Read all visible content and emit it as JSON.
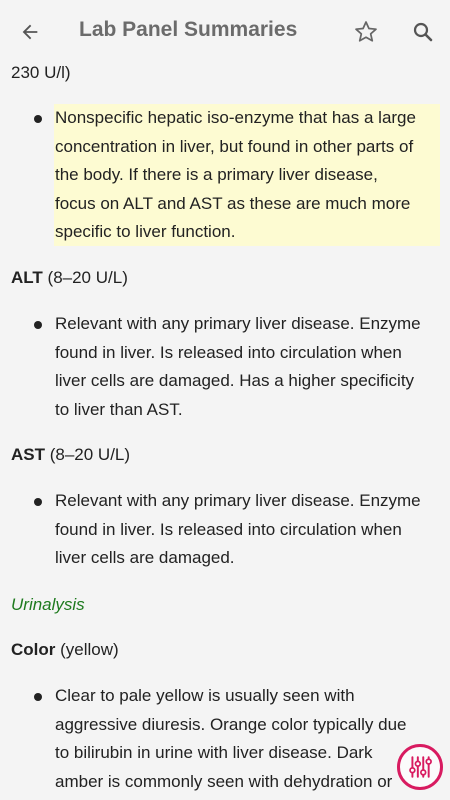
{
  "app_bar": {
    "title": "Lab Panel Summaries",
    "icons": {
      "back": "arrow-back-icon",
      "favorite": "star-outline-icon",
      "search": "search-icon"
    }
  },
  "content": {
    "top_fragment": "230 U/l)",
    "ggt_bullet": {
      "lines": [
        "Nonspecific hepatic iso-enzyme that has a large",
        "concentration in liver, but found in other parts of",
        "the body. If there is a primary liver disease,",
        "focus on ALT and AST as these are much more",
        "specific to liver function."
      ],
      "highlight_color": "#fdfbd2"
    },
    "alt": {
      "name": "ALT",
      "range": "(8–20 U/L)",
      "bullet_lines": [
        "Relevant with any primary liver disease. Enzyme",
        "found in liver. Is released into circulation when",
        "liver cells are damaged. Has a higher specificity",
        "to liver than AST."
      ]
    },
    "ast": {
      "name": "AST",
      "range": "(8–20 U/L)",
      "bullet_lines": [
        "Relevant with any primary liver disease. Enzyme",
        "found in liver. Is released into circulation when",
        "liver cells are damaged."
      ]
    },
    "urinalysis": {
      "heading": "Urinalysis",
      "heading_color": "#1e7a1e"
    },
    "color": {
      "name": "Color",
      "range": "(yellow)",
      "bullet_lines": [
        "Clear to pale yellow is usually seen with",
        "aggressive diuresis. Orange color typically due",
        "to bilirubin in urine with liver disease. Dark",
        "amber is commonly seen with dehydration or"
      ]
    }
  },
  "fab": {
    "icon": "sliders-icon",
    "color": "#d81b60"
  }
}
